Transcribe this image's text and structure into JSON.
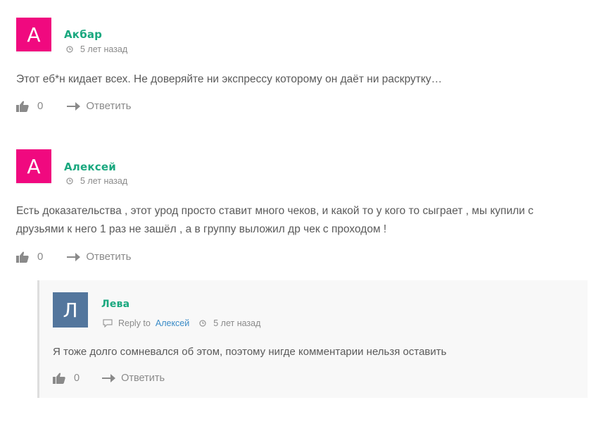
{
  "comments": [
    {
      "avatar_letter": "А",
      "author": "Акбар",
      "time": "5 лет назад",
      "text": "Этот еб*н кидает всех. Не доверяйте ни экспрессу которому он даёт ни раскрутку…",
      "likes": "0",
      "reply_label": "Ответить"
    },
    {
      "avatar_letter": "А",
      "author": "Алексей",
      "time": "5 лет назад",
      "text_line1": "Есть доказательства , этот урод просто ставит много чеков, и какой то у кого то сыграет , мы купили с",
      "text_line2": "друзьями к него 1 раз не зашёл , а в группу выложил др чек с проходом !",
      "likes": "0",
      "reply_label": "Ответить"
    }
  ],
  "reply": {
    "avatar_letter": "Л",
    "author": "Лева",
    "reply_to_label": "Reply to",
    "reply_to_name": "Алексей",
    "time": "5 лет назад",
    "text": "Я тоже долго сомневался об этом, поэтому нигде комментарии нельзя оставить",
    "likes": "0",
    "reply_label": "Ответить"
  },
  "colors": {
    "author": "#1aa87f",
    "avatar_pink": "#f0097f",
    "avatar_blue": "#53769d",
    "link": "#3a8bc7"
  },
  "icons": [
    "clock-icon",
    "thumbs-up-icon",
    "reply-arrow-icon",
    "speech-bubble-icon"
  ]
}
